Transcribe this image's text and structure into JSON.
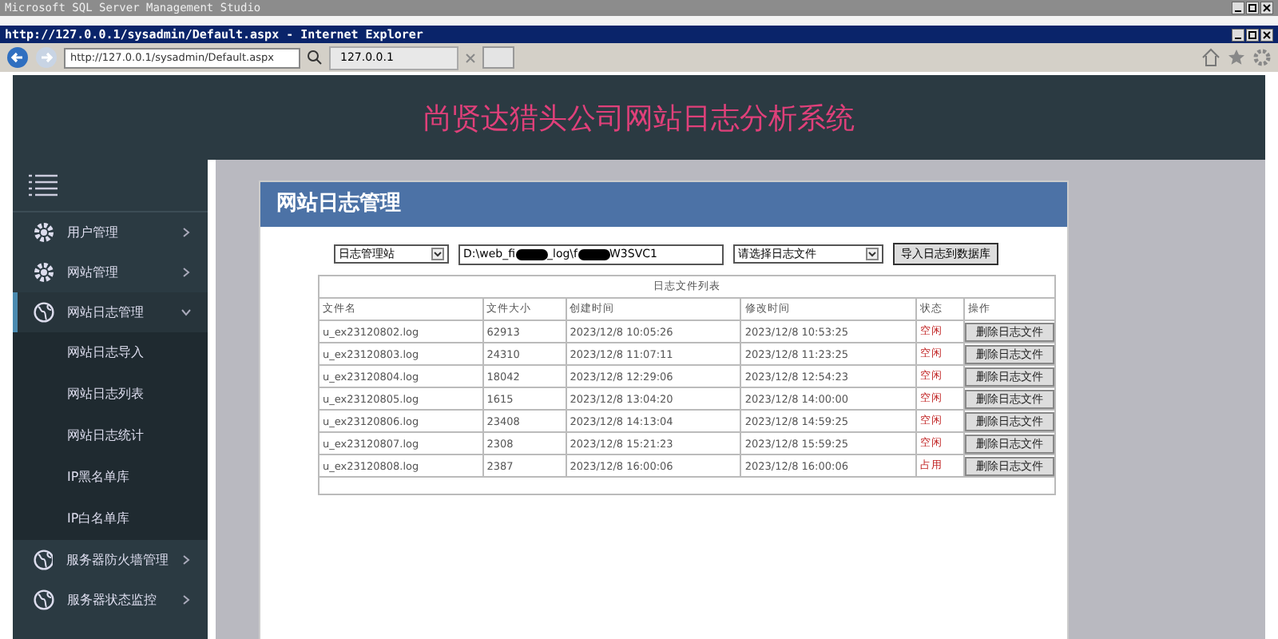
{
  "outer_window": {
    "title": "Microsoft SQL Server Management Studio"
  },
  "browser": {
    "title": "http://127.0.0.1/sysadmin/Default.aspx - Internet Explorer",
    "address": "http://127.0.0.1/sysadmin/Default.aspx",
    "tab": "127.0.0.1"
  },
  "header": {
    "title": "尚贤达猎头公司网站日志分析系统"
  },
  "sidebar": {
    "items": [
      {
        "label": "用户管理",
        "kind": "gear",
        "expanded": false,
        "selected": false
      },
      {
        "label": "网站管理",
        "kind": "gear",
        "expanded": false,
        "selected": false
      },
      {
        "label": "网站日志管理",
        "kind": "globe",
        "expanded": true,
        "selected": true,
        "children": [
          "网站日志导入",
          "网站日志列表",
          "网站日志统计",
          "IP黑名单库",
          "IP白名单库"
        ]
      },
      {
        "label": "服务器防火墙管理",
        "kind": "globe",
        "expanded": false,
        "selected": false
      },
      {
        "label": "服务器状态监控",
        "kind": "globe",
        "expanded": false,
        "selected": false
      }
    ]
  },
  "panel": {
    "title": "网站日志管理",
    "site_select": "日志管理站",
    "path_parts": [
      "D:\\web_fi",
      "_log\\f",
      "W3SVC1"
    ],
    "file_select": "请选择日志文件",
    "import_button": "导入日志到数据库",
    "table": {
      "caption": "日志文件列表",
      "columns": [
        "文件名",
        "文件大小",
        "创建时间",
        "修改时间",
        "状态",
        "操作"
      ],
      "rows": [
        [
          "u_ex23120802.log",
          "62913",
          "2023/12/8 10:05:26",
          "2023/12/8 10:53:25",
          "空闲",
          "删除日志文件"
        ],
        [
          "u_ex23120803.log",
          "24310",
          "2023/12/8 11:07:11",
          "2023/12/8 11:23:25",
          "空闲",
          "删除日志文件"
        ],
        [
          "u_ex23120804.log",
          "18042",
          "2023/12/8 12:29:06",
          "2023/12/8 12:54:23",
          "空闲",
          "删除日志文件"
        ],
        [
          "u_ex23120805.log",
          "1615",
          "2023/12/8 13:04:20",
          "2023/12/8 14:00:00",
          "空闲",
          "删除日志文件"
        ],
        [
          "u_ex23120806.log",
          "23408",
          "2023/12/8 14:13:04",
          "2023/12/8 14:59:25",
          "空闲",
          "删除日志文件"
        ],
        [
          "u_ex23120807.log",
          "2308",
          "2023/12/8 15:21:23",
          "2023/12/8 15:59:25",
          "空闲",
          "删除日志文件"
        ],
        [
          "u_ex23120808.log",
          "2387",
          "2023/12/8 16:00:06",
          "2023/12/8 16:00:06",
          "占用",
          "删除日志文件"
        ]
      ]
    }
  }
}
